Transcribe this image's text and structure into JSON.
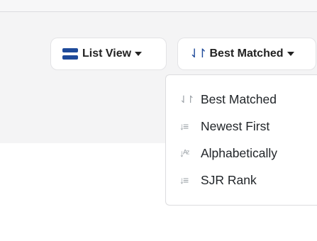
{
  "toolbar": {
    "view_button": {
      "label": "List View",
      "icon": "list-view-icon"
    },
    "sort_button": {
      "label": "Best Matched",
      "icon": "sort-arrows-icon",
      "glyph": "⇃↾"
    }
  },
  "sort_menu": {
    "items": [
      {
        "label": "Best Matched",
        "icon": "sort-arrows-icon",
        "glyph": "⇃↾"
      },
      {
        "label": "Newest First",
        "icon": "sort-amount-down-icon",
        "glyph": "↓≡"
      },
      {
        "label": "Alphabetically",
        "icon": "sort-alpha-icon",
        "glyph": "↓ᴬᶻ"
      },
      {
        "label": "SJR Rank",
        "icon": "sort-numeric-icon",
        "glyph": "↓≡"
      }
    ]
  },
  "colors": {
    "accent": "#1e4a9a",
    "panel_bg": "#f4f4f5"
  }
}
